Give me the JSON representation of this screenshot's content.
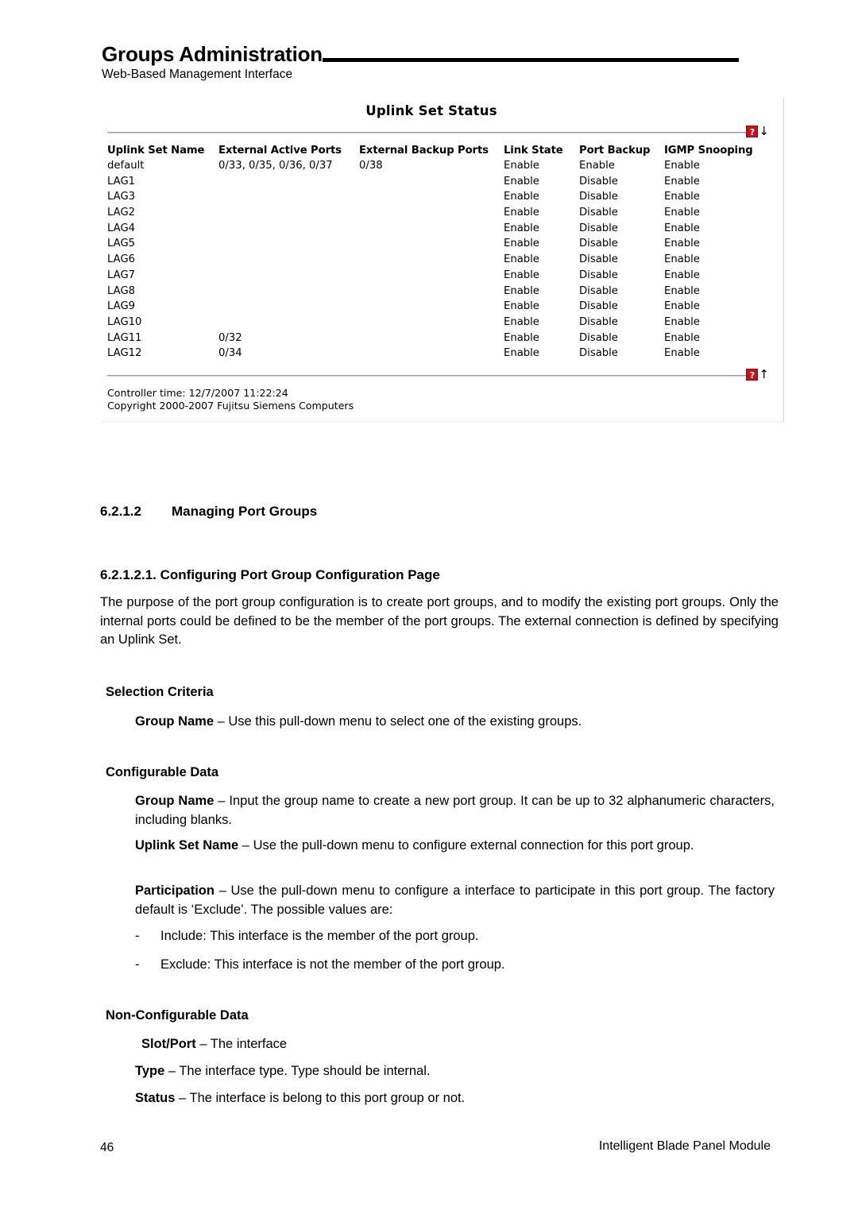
{
  "header": {
    "title": "Groups Administration",
    "subtitle": "Web-Based Management Interface"
  },
  "app_screenshot": {
    "title": "Uplink Set Status",
    "help_icon": "help-question-icon",
    "top_arrow_icon": "arrow-down-icon",
    "bottom_arrow_icon": "arrow-up-icon",
    "help_label": "?",
    "arrow_down_glyph": "↓",
    "arrow_up_glyph": "↑",
    "accent_color": "#c3121a",
    "table": {
      "columns": [
        "Uplink Set Name",
        "External Active Ports",
        "External Backup Ports",
        "Link State",
        "Port Backup",
        "IGMP Snooping"
      ],
      "rows": [
        [
          "default",
          "0/33, 0/35, 0/36, 0/37",
          "0/38",
          "Enable",
          "Enable",
          "Enable"
        ],
        [
          "LAG1",
          "",
          "",
          "Enable",
          "Disable",
          "Enable"
        ],
        [
          "LAG3",
          "",
          "",
          "Enable",
          "Disable",
          "Enable"
        ],
        [
          "LAG2",
          "",
          "",
          "Enable",
          "Disable",
          "Enable"
        ],
        [
          "LAG4",
          "",
          "",
          "Enable",
          "Disable",
          "Enable"
        ],
        [
          "LAG5",
          "",
          "",
          "Enable",
          "Disable",
          "Enable"
        ],
        [
          "LAG6",
          "",
          "",
          "Enable",
          "Disable",
          "Enable"
        ],
        [
          "LAG7",
          "",
          "",
          "Enable",
          "Disable",
          "Enable"
        ],
        [
          "LAG8",
          "",
          "",
          "Enable",
          "Disable",
          "Enable"
        ],
        [
          "LAG9",
          "",
          "",
          "Enable",
          "Disable",
          "Enable"
        ],
        [
          "LAG10",
          "",
          "",
          "Enable",
          "Disable",
          "Enable"
        ],
        [
          "LAG11",
          "0/32",
          "",
          "Enable",
          "Disable",
          "Enable"
        ],
        [
          "LAG12",
          "0/34",
          "",
          "Enable",
          "Disable",
          "Enable"
        ]
      ]
    },
    "controller_time": "Controller time: 12/7/2007 11:22:24",
    "copyright": "Copyright 2000-2007 Fujitsu Siemens Computers"
  },
  "sections": {
    "heading_1": {
      "number": "6.2.1.2",
      "text": "Managing Port Groups"
    },
    "heading_2": "6.2.1.2.1. Configuring Port Group Configuration Page",
    "intro_paragraph": "The purpose of the port group configuration is to create port groups, and to modify the existing port groups. Only the internal ports could be defined to be the member of the port groups. The external connection is defined by specifying an Uplink Set.",
    "selection_criteria": {
      "heading": "Selection Criteria",
      "item_term": "Group Name",
      "item_text": " – Use this pull-down menu to select one of the existing groups."
    },
    "configurable_data": {
      "heading": "Configurable Data",
      "items": [
        {
          "term": "Group Name",
          "text": " – Input the group name to create a new port group. It can be up to 32 alphanumeric characters, including blanks."
        },
        {
          "term": "Uplink Set Name",
          "text": " – Use the pull-down menu to configure external connection for this port group."
        },
        {
          "term": "Participation",
          "text": " – Use the pull-down menu to configure a interface to participate in this port group. The factory default is ‘Exclude’. The possible values are:"
        }
      ],
      "bullets": [
        {
          "dash": "-",
          "text": "Include: This interface is the member of the port group."
        },
        {
          "dash": "-",
          "text": "Exclude: This interface is not the member of the port group."
        }
      ]
    },
    "non_configurable_data": {
      "heading": "Non-Configurable Data",
      "items": [
        {
          "term": "Slot/Port",
          "text": " – The interface"
        },
        {
          "term": "Type",
          "text": " – The interface type. Type should be internal."
        },
        {
          "term": "Status",
          "text": " – The interface is belong to this port group or not."
        }
      ]
    }
  },
  "page_footer": {
    "page_number": "46",
    "product": "Intelligent Blade Panel Module"
  }
}
